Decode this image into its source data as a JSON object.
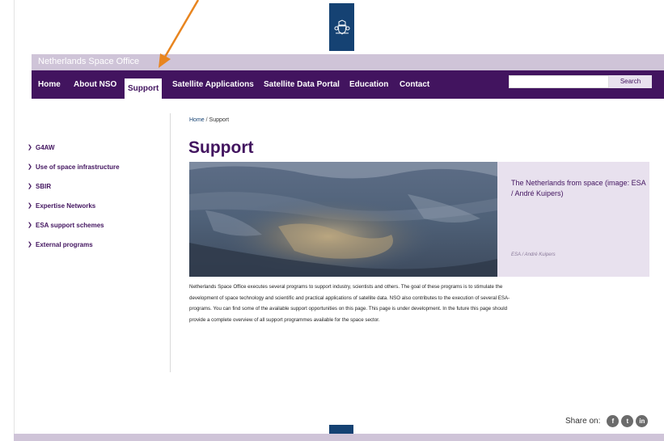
{
  "site": {
    "title": "Netherlands Space Office",
    "logo_icon": "crest-icon"
  },
  "nav": {
    "items": [
      {
        "label": "Home"
      },
      {
        "label": "About NSO"
      },
      {
        "label": "Support",
        "active": true
      },
      {
        "label": "Satellite Applications"
      },
      {
        "label": "Satellite Data Portal"
      },
      {
        "label": "Education"
      },
      {
        "label": "Contact"
      }
    ],
    "search_value": "",
    "search_button": "Search"
  },
  "sidebar": {
    "items": [
      {
        "label": "G4AW"
      },
      {
        "label": "Use of space infrastructure"
      },
      {
        "label": "SBIR"
      },
      {
        "label": "Expertise Networks"
      },
      {
        "label": "ESA support schemes"
      },
      {
        "label": "External programs"
      }
    ]
  },
  "breadcrumb": {
    "home": "Home",
    "separator": "/",
    "current": "Support"
  },
  "main": {
    "title": "Support",
    "image_caption": "The Netherlands from space (image: ESA / André Kuipers)",
    "image_credit": "ESA / André Kuipers",
    "body": "Netherlands Space Office executes several programs to support industry, scientists and others. The goal of these programs is to stimulate the development of space technology and scientific and practical applications of satellite data. NSO also contributes to the execution of several ESA-programs. You can find some of the available support opportunities on this page. This page is under development. In the future this page should provide a complete overview of all support programmes available for the space sector."
  },
  "share": {
    "label": "Share on:",
    "buttons": [
      {
        "icon": "facebook-icon",
        "glyph": "f"
      },
      {
        "icon": "twitter-icon",
        "glyph": "t"
      },
      {
        "icon": "linkedin-icon",
        "glyph": "in"
      }
    ]
  },
  "colors": {
    "brand_purple": "#42145f",
    "light_purple": "#cfc4d8",
    "caption_bg": "#e8e1ee",
    "logo_blue": "#154273",
    "annotation_arrow": "#e8851f"
  }
}
